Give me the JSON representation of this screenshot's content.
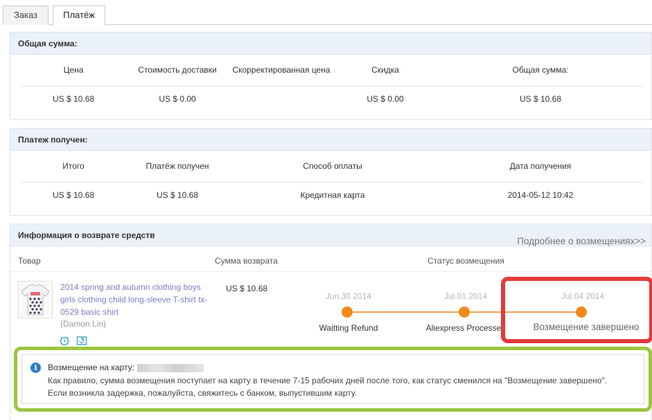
{
  "tabs": [
    {
      "label": "Заказ",
      "active": false
    },
    {
      "label": "Платёж",
      "active": true
    }
  ],
  "summary": {
    "title": "Общая сумма:",
    "headers": [
      "Цена",
      "Стоимость доставки",
      "Скорректированная цена",
      "Скидка",
      "Общая сумма:"
    ],
    "values": [
      "US $ 10.68",
      "US $ 0.00",
      "",
      "US $ 0.00",
      "US $ 10.68"
    ]
  },
  "payment": {
    "title": "Платеж получен:",
    "headers": [
      "Итого",
      "Платёж получен",
      "Способ оплаты",
      "Дата получения"
    ],
    "values": [
      "US $ 10.68",
      "US $ 10.68",
      "Кредитная карта",
      "2014-05-12 10:42"
    ]
  },
  "refund": {
    "title": "Информация о возврате средств",
    "more_link": "Подробнее о возмещениях>>",
    "headers": {
      "product": "Товар",
      "amount": "Сумма возврата",
      "status": "Статус возмещения"
    },
    "product": {
      "title": "2014 spring and autumn clothing boys girls clothing child long-sleeve T-shirt tx-0529 basic shirt",
      "seller": "(Damon Lin)",
      "icons": [
        "clock-icon",
        "refresh-icon"
      ]
    },
    "amount": "US $ 10.68",
    "timeline": [
      {
        "date": "Jun.30 2014",
        "label": "Waitting Refund"
      },
      {
        "date": "Jul.01 2014",
        "label": "Aliexpress Processe"
      },
      {
        "date": "Jul.04 2014",
        "label": "Возмещение завершено"
      }
    ],
    "highlight_color": "#e23b3b"
  },
  "notice": {
    "title": "Возмещение на карту:",
    "lines": [
      "Как правило, сумма возмещения поступает на карту в течение 7-15 рабочих дней после того, как статус сменился на \"Возмещение завершено\".",
      "Если возникла задержка, пожалуйста, свяжитесь с банком, выпустившим карту."
    ],
    "highlight_color": "#9cc63f"
  },
  "colors": {
    "panel_header_bg": "#eaf1f8",
    "timeline_accent": "#f28a19",
    "product_link": "#7b7fc4",
    "info_icon": "#2c7dc6"
  }
}
